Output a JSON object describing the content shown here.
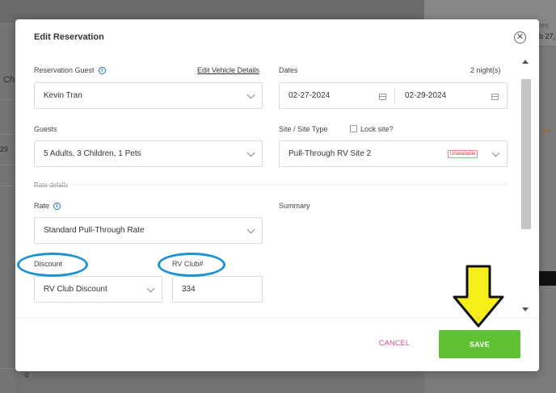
{
  "background": {
    "left_partial_text_1": "Ch",
    "left_partial_text_2": "29",
    "left_partial_text_3": "0",
    "right_partial_text_1": "tes",
    "right_partial_text_2": "b 27,",
    "right_partial_text_3": "m"
  },
  "modal": {
    "title": "Edit Reservation",
    "close_icon": "close-icon"
  },
  "form": {
    "guest_label": "Reservation Guest",
    "edit_vehicle_link": "Edit Vehicle Details",
    "guest_value": "Kevin Tran",
    "dates_label": "Dates",
    "nights": "2 night(s)",
    "date_start": "02-27-2024",
    "date_end": "02-29-2024",
    "guests_label": "Guests",
    "guests_value": "5 Adults, 3 Children, 1 Pets",
    "site_label": "Site / Site Type",
    "lock_site_label": "Lock site?",
    "site_value": "Pull-Through RV Site 2",
    "site_badge": "Unavailable",
    "rate_details_label": "Rate details",
    "rate_label": "Rate",
    "rate_value": "Standard Pull-Through Rate",
    "summary_label": "Summary",
    "discount_label": "Discount",
    "discount_value": "RV Club Discount",
    "rv_club_label": "RV Club#",
    "rv_club_value": "334"
  },
  "footer": {
    "cancel_label": "CANCEL",
    "save_label": "SAVE"
  },
  "colors": {
    "save_green": "#5ec232",
    "cancel_pink": "#d64a8c",
    "annotation_blue": "#1b93d2",
    "annotation_arrow_yellow": "#f7ef1a",
    "info_blue": "#1d6fc9"
  }
}
